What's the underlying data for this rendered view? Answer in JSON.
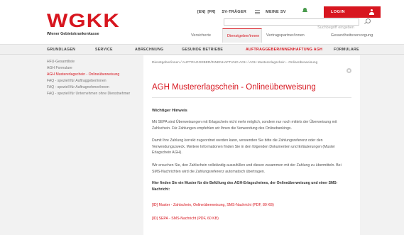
{
  "brand": {
    "logo_text": "WGKK",
    "subtitle": "Wiener Gebietskrankenkasse"
  },
  "topbar": {
    "languages": [
      "[EN]",
      "[FR]"
    ],
    "sv_traeger": "SV-TRÄGER",
    "meine_sv": "MEINE SV",
    "login": "LOGIN"
  },
  "search": {
    "placeholder": "Suchbegriff eingeben"
  },
  "audience_tabs": [
    {
      "label": "Versicherte",
      "active": false
    },
    {
      "label": "Dienstgeber/innen",
      "active": true
    },
    {
      "label": "Vertragspartner/innen",
      "active": false
    },
    {
      "label": "Gesundheitsversorgung",
      "active": false
    }
  ],
  "main_nav": [
    {
      "label": "GRUNDLAGEN",
      "active": false
    },
    {
      "label": "SERVICE",
      "active": false
    },
    {
      "label": "ABRECHNUNG",
      "active": false
    },
    {
      "label": "GESUNDE BETRIEBE",
      "active": false
    },
    {
      "label": "AUFTRAGGEBER/INNENHAFTUNG AGH",
      "active": true
    },
    {
      "label": "FORMULARE",
      "active": false
    }
  ],
  "sidebar": {
    "items": [
      {
        "label": "HFU-Gesamtliste",
        "active": false
      },
      {
        "label": "AGH Formulare",
        "active": false
      },
      {
        "label": "AGH Mustererlagschein - Onlineüberweisung",
        "active": true
      },
      {
        "label": "FAQ - speziell für Auftraggeber/innen",
        "active": false
      },
      {
        "label": "FAQ - speziell für Auftragnehmer/innen",
        "active": false
      },
      {
        "label": "FAQ - speziell für Unternehmen ohne Dienstnehmer",
        "active": false
      }
    ]
  },
  "content": {
    "breadcrumb": "Dienstgeber/innen / AUFTRAGGEBER/INNENHAFTUNG AGH / AGH Mustererlagschein - Onlineüberweisung",
    "title": "AGH Mustererlagschein - Onlineüberweisung",
    "section_title": "Wichtiger Hinweis",
    "paragraphs": [
      "Mit SEPA sind Überweisungen mit Erlagschein nicht mehr möglich, sondern nur noch mittels der Überweisung mit Zahlschein. Für Zahlungen empfehlen wir Ihnen die Verwendung des Onlinebankings.",
      "Damit Ihre Zahlung korrekt zugeordnet werden kann, verwenden Sie bitte die Zahlungsreferenz oder den Verwendungszweck. Weitere Informationen finden Sie in den folgenden Dokumenten und Erläuterungen (Muster Erlagschein AGH).",
      "Wir ersuchen Sie, den Zahlschein vollständig auszufüllen und diesen zusammen mit der Zahlung zu übermitteln. Bei SMS-Nachrichten wird die Zahlungsreferenz automatisch übertragen."
    ],
    "bold_paragraph": "Hier finden Sie ein Muster für die Befüllung des AGH-Erlagscheines, der Onlineüberweisung und einer SMS-Nachricht:",
    "links": [
      "[ID] Muster - Zahlschein, Onlineüberweisung, SMS-Nachricht (PDF, 80 KB)",
      "[ID] SEPA - SMS-Nachricht (PDF, 60 KB)"
    ]
  }
}
